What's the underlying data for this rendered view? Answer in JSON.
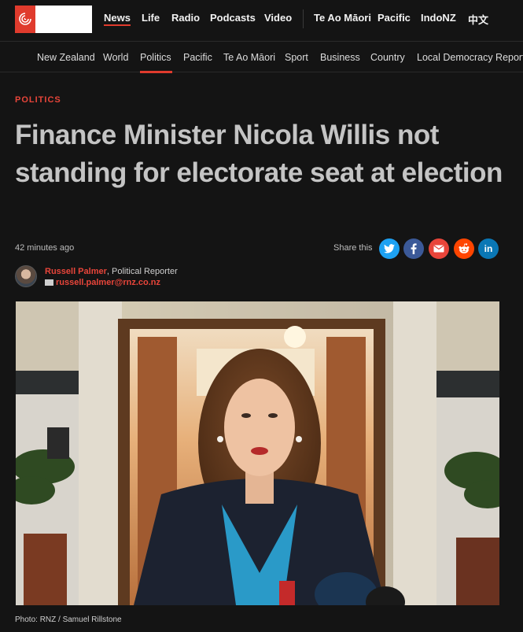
{
  "primary_nav": {
    "items": [
      "News",
      "Life",
      "Radio",
      "Podcasts",
      "Video",
      "Te Ao Māori",
      "Pacific",
      "IndoNZ",
      "中文"
    ],
    "active": "News"
  },
  "secondary_nav": {
    "items": [
      "New Zealand",
      "World",
      "Politics",
      "Pacific",
      "Te Ao Māori",
      "Sport",
      "Business",
      "Country",
      "Local Democracy Reporti"
    ],
    "active": "Politics"
  },
  "article": {
    "kicker": "POLITICS",
    "headline": "Finance Minister Nicola Willis not standing for electorate seat at election",
    "timestamp": "42 minutes ago",
    "share_label": "Share this",
    "author_name": "Russell Palmer",
    "author_role": ", Political Reporter",
    "author_email": "russell.palmer@rnz.co.nz",
    "photo_caption": "Photo: RNZ / Samuel Rillstone"
  },
  "share_buttons": [
    {
      "name": "twitter",
      "glyph": "t",
      "color": "#1da1f2"
    },
    {
      "name": "facebook",
      "glyph": "f",
      "color": "#3b5998"
    },
    {
      "name": "email",
      "glyph": "✉",
      "color": "#e8453a"
    },
    {
      "name": "reddit",
      "glyph": "r",
      "color": "#ff4500"
    },
    {
      "name": "linkedin",
      "glyph": "in",
      "color": "#0a77b5"
    }
  ],
  "colors": {
    "accent": "#e03b2d",
    "background": "#141414"
  }
}
